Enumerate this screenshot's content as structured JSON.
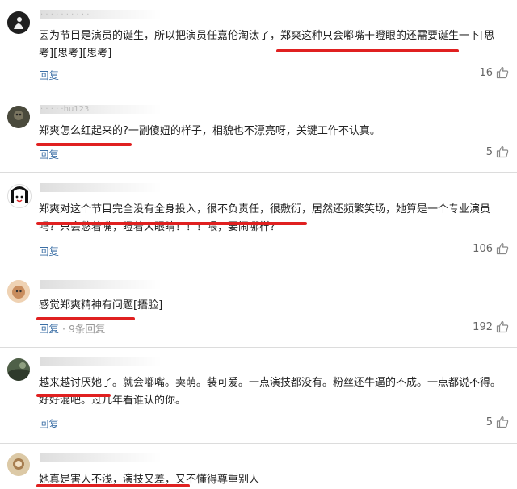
{
  "comments": [
    {
      "username": "· · · · ·  · · · · ·",
      "text": "因为节目是演员的诞生，所以把演员任嘉伦淘汰了，郑爽这种只会嘟嘴干瞪眼的还需要诞生一下[思考][思考][思考]",
      "reply": "回复",
      "likes": "16"
    },
    {
      "username": "· · · · ·hu123",
      "text": "郑爽怎么红起来的?一副傻妞的样子，相貌也不漂亮呀，关键工作不认真。",
      "reply": "回复",
      "likes": "5"
    },
    {
      "username": "",
      "text": "郑爽对这个节目完全没有全身投入，很不负责任，很敷衍，居然还频繁笑场，她算是一个专业演员吗？只会憋着嘴，瞪着大眼睛！！！喂，要闹哪样？",
      "reply": "回复",
      "likes": "106"
    },
    {
      "username": "",
      "text": "感觉郑爽精神有问题[捂脸]",
      "reply": "回复",
      "subreplies": "· 9条回复",
      "likes": "192"
    },
    {
      "username": "",
      "text": "越来越讨厌她了。就会嘟嘴。卖萌。装可爱。一点演技都没有。粉丝还牛逼的不成。一点都说不得。好好混吧。过几年看谁认的你。",
      "reply": "回复",
      "likes": "5"
    },
    {
      "username": "",
      "text": "她真是害人不浅，演技又差，又不懂得尊重别人",
      "reply": "",
      "likes": ""
    }
  ],
  "icons": {
    "like": "thumbs-up-icon"
  },
  "colors": {
    "underline": "#e02020",
    "reply": "#3a6ea5"
  }
}
